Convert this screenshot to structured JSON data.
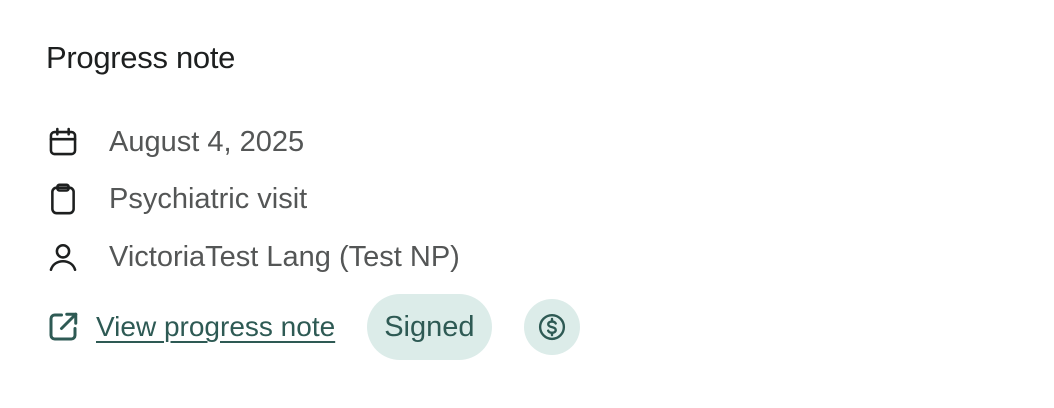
{
  "card": {
    "title": "Progress note",
    "details": [
      {
        "icon": "calendar-icon",
        "text": "August 4, 2025"
      },
      {
        "icon": "clipboard-icon",
        "text": "Psychiatric visit"
      },
      {
        "icon": "user-icon",
        "text": "VictoriaTest Lang (Test NP)"
      }
    ],
    "actions": {
      "link_icon": "external-link-icon",
      "link_label": "View progress note",
      "status_badge": "Signed",
      "billing_icon": "dollar-circle-icon"
    }
  },
  "colors": {
    "title": "#1d1f1f",
    "detail_text": "#545656",
    "accent": "#2e5a54",
    "badge_background": "#dcece9"
  }
}
